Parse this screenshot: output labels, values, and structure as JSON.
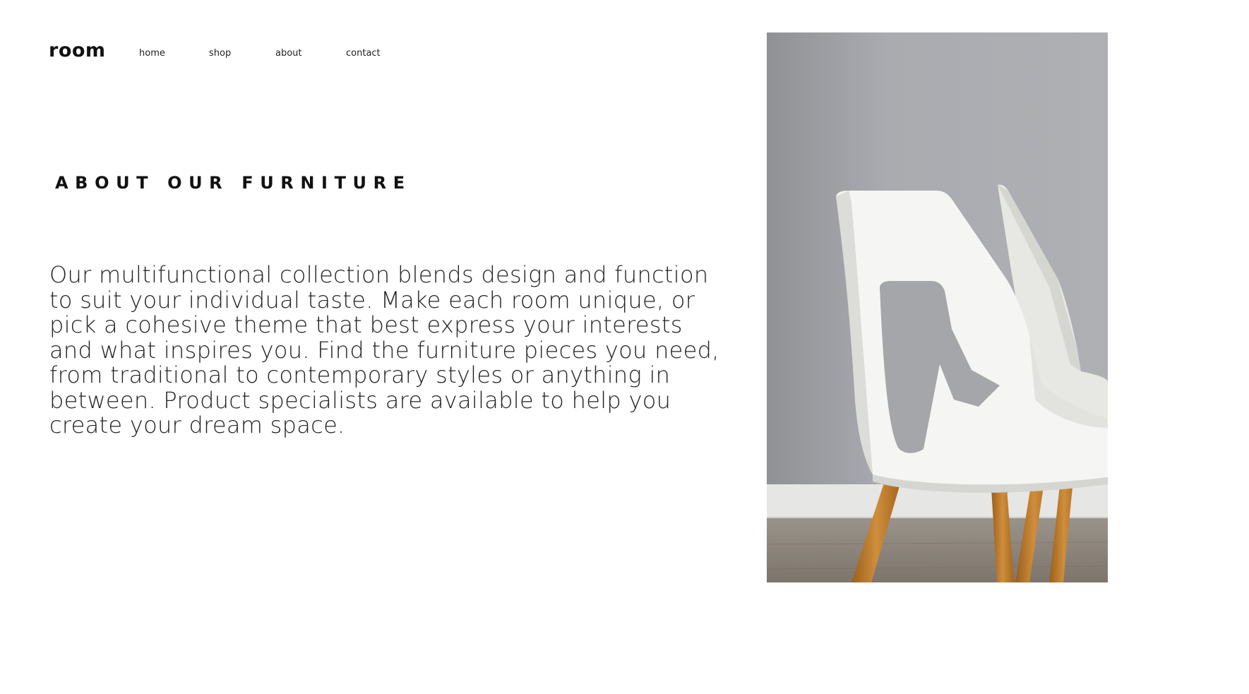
{
  "header": {
    "logo": "room",
    "nav": [
      {
        "label": "home"
      },
      {
        "label": "shop"
      },
      {
        "label": "about"
      },
      {
        "label": "contact"
      }
    ]
  },
  "main": {
    "heading": "ABOUT OUR FURNITURE",
    "body": "Our multifunctional collection blends design and function to suit your individual taste. Make each room unique, or pick a cohesive theme that best express your interests and what inspires you. Find the furniture pieces you need, from traditional to contemporary styles or anything in between. Product specialists are available to help you create your dream space."
  },
  "colors": {
    "background": "#ffffff",
    "text": "#111111",
    "wall": "#a7a9ad",
    "chair": "#f4f4f2",
    "wood": "#b8782c",
    "floor": "#8d8378"
  }
}
